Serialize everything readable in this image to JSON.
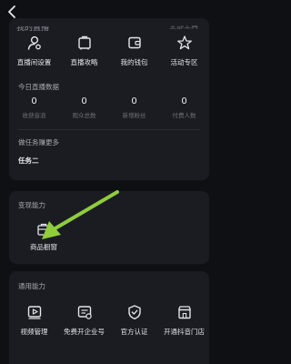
{
  "header": {
    "back_icon": "chevron-left-icon",
    "partial_title": "我的直播",
    "partial_right": "全部工具"
  },
  "quick_actions": [
    {
      "label": "直播间设置",
      "icon": "user-settings-icon"
    },
    {
      "label": "直播攻略",
      "icon": "briefcase-icon"
    },
    {
      "label": "我的钱包",
      "icon": "wallet-icon"
    },
    {
      "label": "活动专区",
      "icon": "star-icon"
    }
  ],
  "today_stats": {
    "title": "今日直播数据",
    "items": [
      {
        "value": "0",
        "label": "收获音浪"
      },
      {
        "value": "0",
        "label": "观众总数"
      },
      {
        "value": "0",
        "label": "新增粉丝"
      },
      {
        "value": "0",
        "label": "付费人数"
      }
    ]
  },
  "tasks": {
    "title": "做任务赚更多",
    "item": "任务二"
  },
  "monetization": {
    "title": "变现能力",
    "item": {
      "label": "商品橱窗",
      "icon": "store-window-icon"
    }
  },
  "general": {
    "title": "通用能力",
    "items": [
      {
        "label": "视频管理",
        "icon": "video-manage-icon"
      },
      {
        "label": "免费开企业号",
        "icon": "enterprise-icon"
      },
      {
        "label": "官方认证",
        "icon": "shield-check-icon"
      },
      {
        "label": "开通抖音门店",
        "icon": "store-icon"
      }
    ]
  },
  "colors": {
    "background": "#0f1014",
    "card": "#1b1c22",
    "arrow": "#8fcd3c"
  }
}
